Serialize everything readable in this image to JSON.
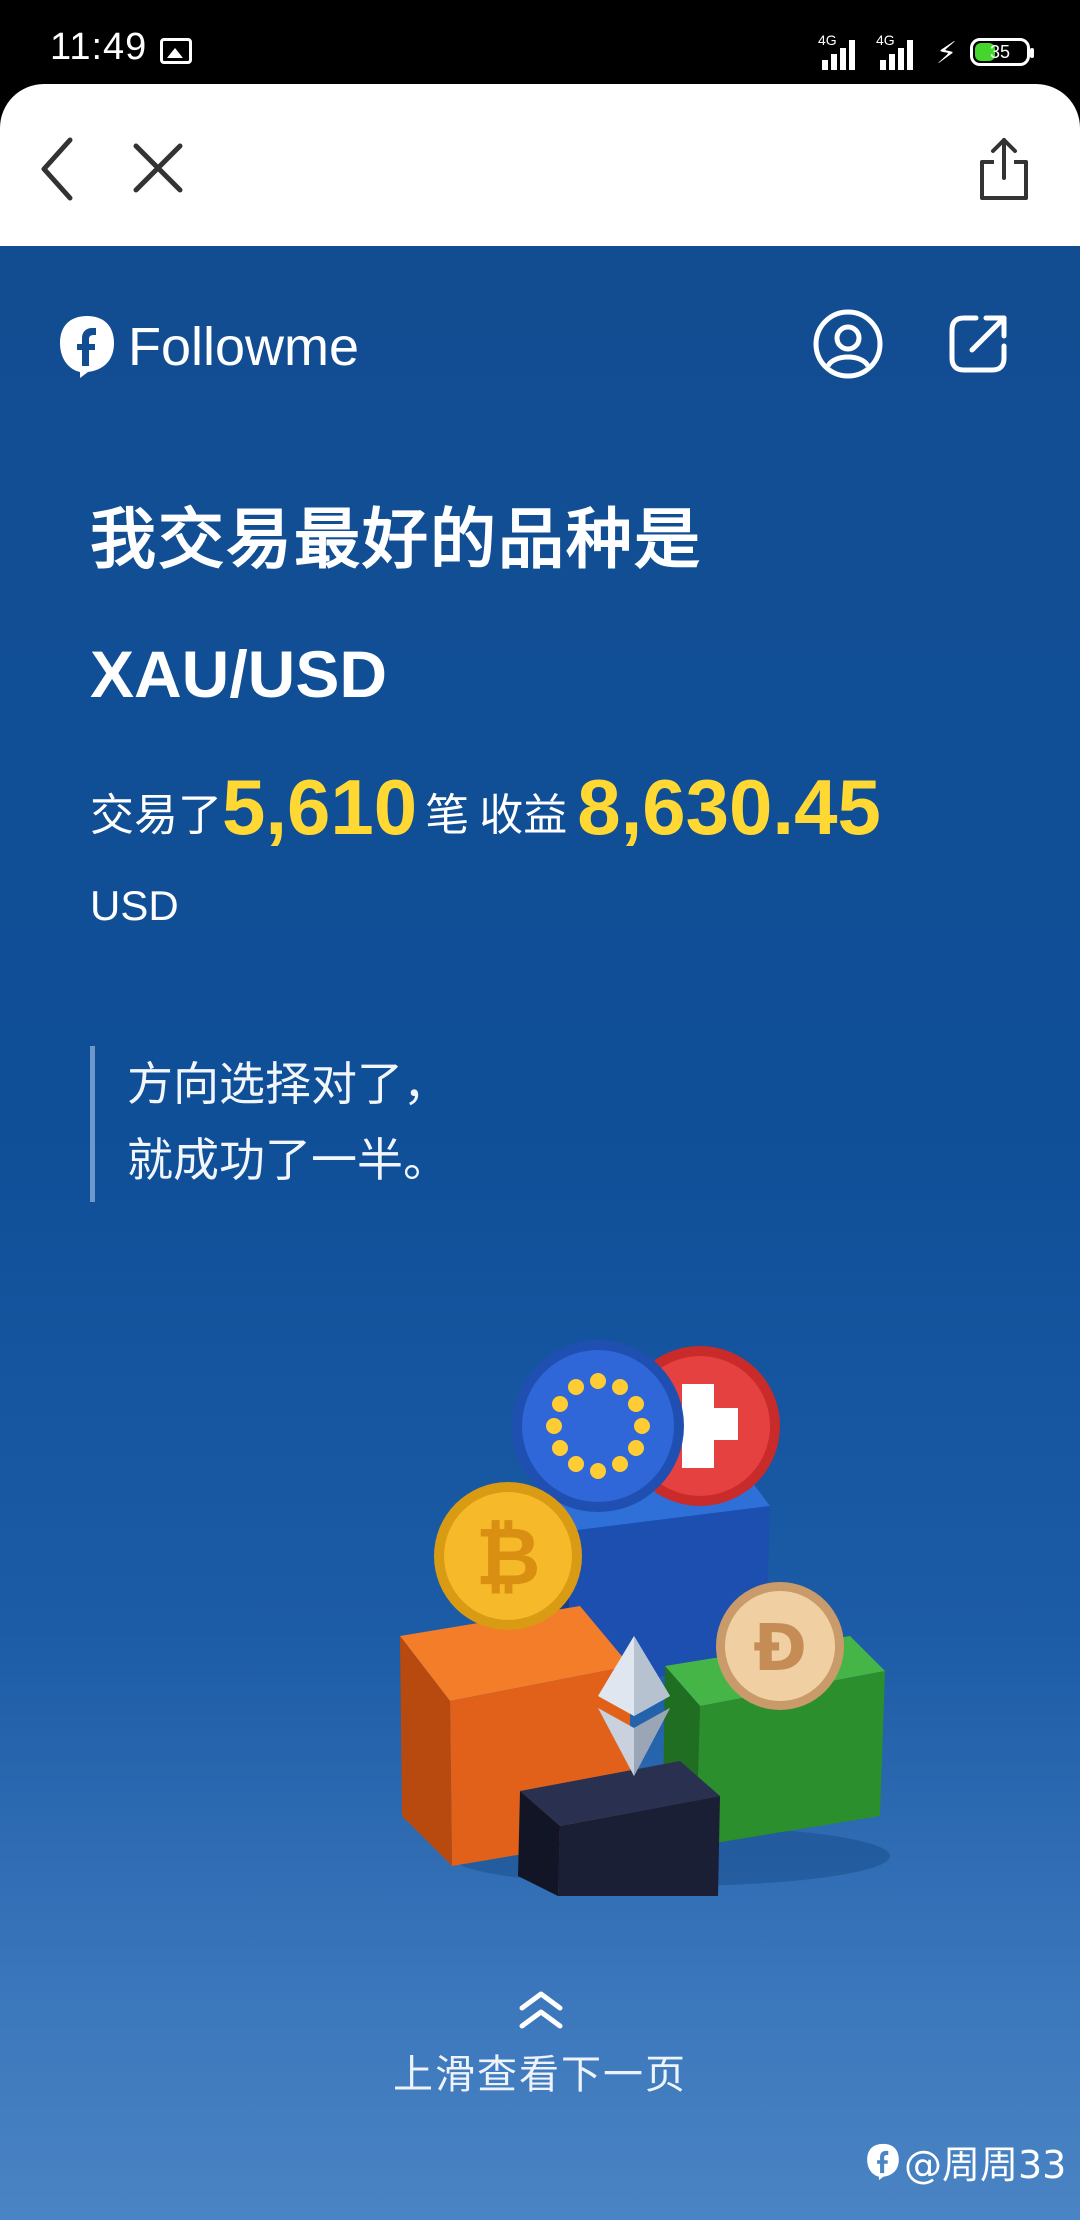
{
  "status_bar": {
    "time": "11:49",
    "network_1": "4G",
    "network_2": "4G",
    "battery": "35",
    "battery_color": "#44d62c"
  },
  "browser_bar": {
    "back_icon": "chevron-left-icon",
    "close_icon": "close-icon",
    "share_icon": "share-icon"
  },
  "header": {
    "brand_name": "Followme",
    "logo_icon": "followme-logo-icon",
    "profile_icon": "profile-circle-icon",
    "external_icon": "external-link-icon"
  },
  "main": {
    "headline": "我交易最好的品种是",
    "symbol": "XAU/USD",
    "stats": {
      "prefix": "交易了",
      "trades": "5,610",
      "trades_unit": "笔",
      "profit_label": "收益",
      "profit": "8,630.45",
      "currency": "USD"
    },
    "quote": {
      "line1": "方向选择对了，",
      "line2": "就成功了一半。"
    },
    "illustration": "currency-blocks-illustration",
    "accent_color": "#ffd833",
    "background_color": "#124d92"
  },
  "footer": {
    "swipe_icon": "double-chevron-up-icon",
    "swipe_label": "上滑查看下一页",
    "watermark": "@周周33"
  }
}
